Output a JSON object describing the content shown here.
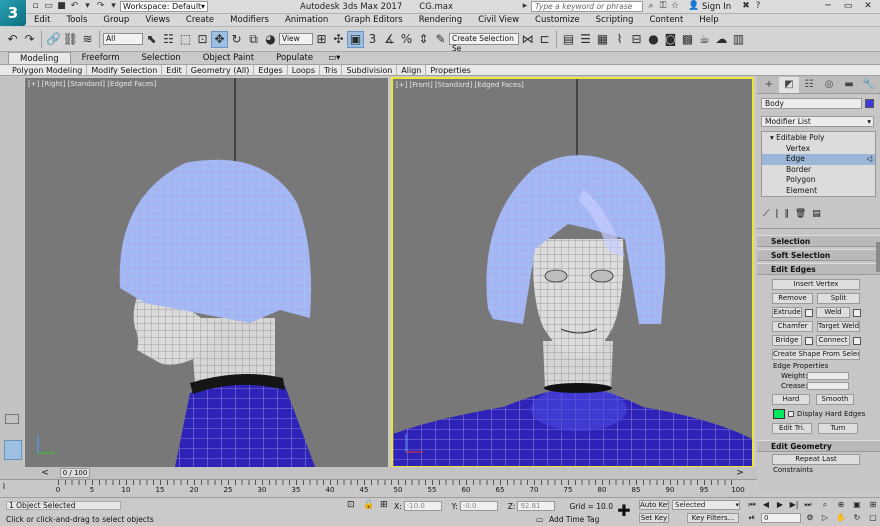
{
  "app": {
    "logo": "3",
    "title": "Autodesk 3ds Max 2017",
    "file": "CG.max",
    "workspace": "Workspace: Default",
    "search_placeholder": "Type a keyword or phrase",
    "sign_in": "Sign In"
  },
  "menus": [
    "Edit",
    "Tools",
    "Group",
    "Views",
    "Create",
    "Modifiers",
    "Animation",
    "Graph Editors",
    "Rendering",
    "Civil View",
    "Customize",
    "Scripting",
    "Content",
    "Help"
  ],
  "toolbar": {
    "selection_filter": "All",
    "ref_coord": "View",
    "named_selection": "Create Selection Se"
  },
  "ribbon": {
    "tabs": [
      "Modeling",
      "Freeform",
      "Selection",
      "Object Paint",
      "Populate"
    ],
    "active_tab": "Modeling",
    "items": [
      "Polygon Modeling",
      "Modify Selection",
      "Edit",
      "Geometry (All)",
      "Edges",
      "Loops",
      "Tris",
      "Subdivision",
      "Align",
      "Properties"
    ]
  },
  "viewports": [
    {
      "label": "[+] [Right] [Standard] [Edged Faces]"
    },
    {
      "label": "[+] [Front] [Standard] [Edged Faces]"
    }
  ],
  "command_panel": {
    "object_name": "Body",
    "modifier_list": "Modifier List",
    "stack": [
      "Editable Poly",
      "Vertex",
      "Edge",
      "Border",
      "Polygon",
      "Element"
    ],
    "stack_selected": "Edge",
    "rollouts": {
      "selection": "Selection",
      "soft_selection": "Soft Selection",
      "edit_edges": "Edit Edges",
      "edit_geometry": "Edit Geometry"
    },
    "buttons": {
      "insert_vertex": "Insert Vertex",
      "remove": "Remove",
      "split": "Split",
      "extrude": "Extrude",
      "weld": "Weld",
      "chamfer": "Chamfer",
      "target_weld": "Target Weld",
      "bridge": "Bridge",
      "connect": "Connect",
      "create_shape": "Create Shape From Selection",
      "hard": "Hard",
      "smooth": "Smooth",
      "edit_tri": "Edit Tri.",
      "turn": "Turn",
      "repeat_last": "Repeat Last"
    },
    "edge_properties": "Edge Properties",
    "weight_label": "Weight:",
    "crease_label": "Crease:",
    "display_hard_edges": "Display Hard Edges",
    "constraints": "Constraints",
    "swatch_color": "#00e85a",
    "object_color": "#3a3ad8"
  },
  "timeline": {
    "frame": "0 / 100",
    "ticks": [
      "0",
      "5",
      "10",
      "15",
      "20",
      "25",
      "30",
      "35",
      "40",
      "45",
      "50",
      "55",
      "60",
      "65",
      "70",
      "75",
      "80",
      "85",
      "90",
      "95",
      "100"
    ]
  },
  "status": {
    "selected": "1 Object Selected",
    "hint": "Click or click-and-drag to select objects",
    "x_label": "X:",
    "x_value": "-10.0",
    "y_label": "Y:",
    "y_value": "-0.0",
    "z_label": "Z:",
    "z_value": "92.81",
    "grid": "Grid = 10.0",
    "add_time_tag": "Add Time Tag",
    "auto_key": "Auto Key",
    "set_key": "Set Key",
    "key_mode": "Selected",
    "key_filters": "Key Filters...",
    "frame_field": "0"
  }
}
